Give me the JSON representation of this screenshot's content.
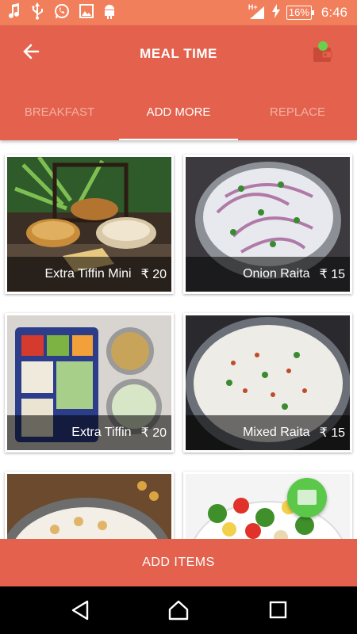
{
  "status_bar": {
    "left_icons": [
      "music-note-icon",
      "usb-icon",
      "whatsapp-icon",
      "image-icon",
      "android-icon"
    ],
    "network": "H+",
    "battery": "16%",
    "time": "6:46"
  },
  "header": {
    "title": "MEAL TIME",
    "back_icon": "arrow-left-icon",
    "wallet_icon": "wallet-icon"
  },
  "tabs": [
    {
      "label": "BREAKFAST",
      "active": false
    },
    {
      "label": "ADD MORE",
      "active": true
    },
    {
      "label": "REPLACE",
      "active": false
    }
  ],
  "items": [
    {
      "name": "Extra Tiffin Mini",
      "price": "₹ 20"
    },
    {
      "name": "Onion Raita",
      "price": "₹ 15"
    },
    {
      "name": "Extra Tiffin",
      "price": "₹ 20"
    },
    {
      "name": "Mixed Raita",
      "price": "₹ 15"
    },
    {
      "name": "",
      "price": ""
    },
    {
      "name": "",
      "price": ""
    }
  ],
  "footer": {
    "add_items_label": "ADD ITEMS"
  },
  "colors": {
    "primary": "#e3614d",
    "status_bar": "#f27f5c",
    "chat_button": "#5cc84a"
  }
}
